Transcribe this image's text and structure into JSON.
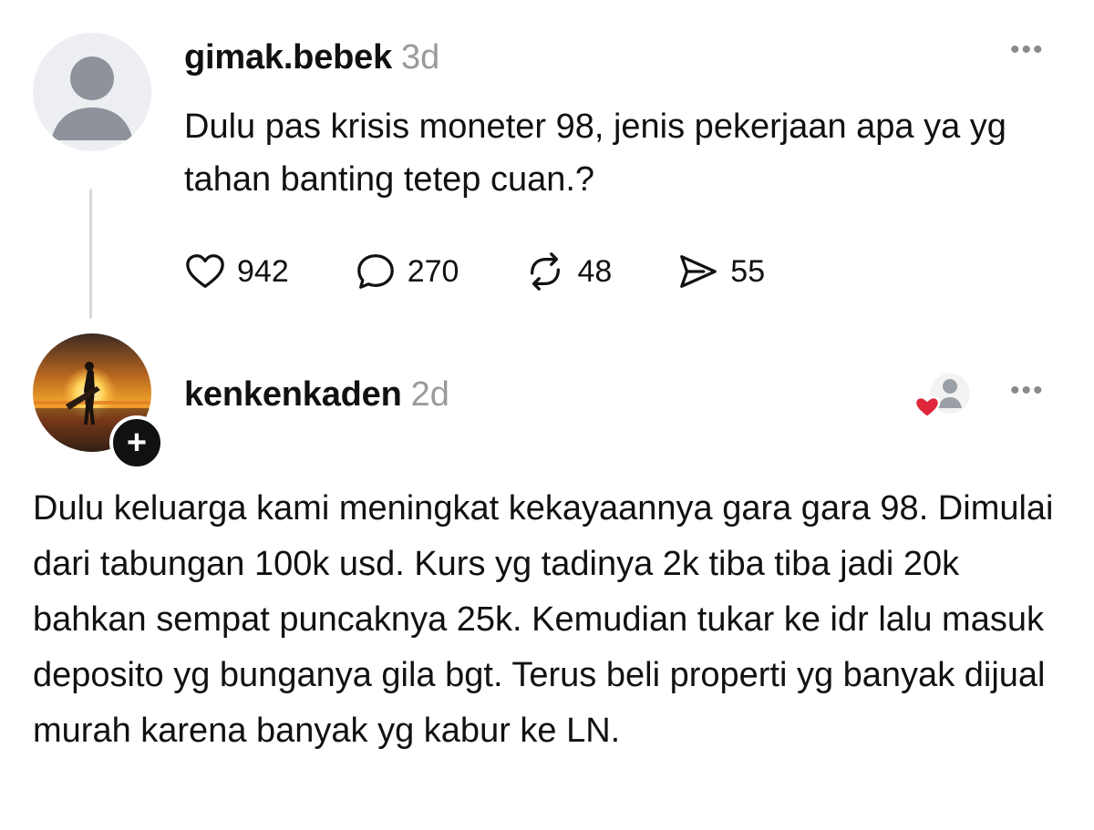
{
  "post": {
    "username": "gimak.bebek",
    "time": "3d",
    "text": "Dulu pas krisis moneter 98, jenis pekerjaan apa ya yg tahan banting tetep cuan.?",
    "more_icon": "more-horizontal-icon",
    "avatar_icon": "default-avatar-icon",
    "actions": {
      "like": {
        "icon": "heart-icon",
        "count": "942"
      },
      "reply": {
        "icon": "comment-icon",
        "count": "270"
      },
      "repost": {
        "icon": "repost-icon",
        "count": "48"
      },
      "share": {
        "icon": "send-icon",
        "count": "55"
      }
    }
  },
  "reply": {
    "username": "kenkenkaden",
    "time": "2d",
    "text": "Dulu keluarga kami meningkat kekayaannya gara gara 98. Dimulai dari tabungan 100k usd. Kurs yg tadinya 2k tiba tiba jadi 20k bahkan sempat puncaknya 25k. Kemudian tukar ke idr lalu masuk deposito yg bunganya gila bgt. Terus beli properti yg banyak dijual murah karena banyak yg kabur ke LN.",
    "follow_label": "+",
    "liked_by_author_icon": "liked-by-author-icon",
    "more_icon": "more-horizontal-icon"
  },
  "colors": {
    "text": "#111111",
    "muted": "#9a9a9a",
    "heart_red": "#e0263a",
    "thread_line": "#d9d9d9"
  }
}
